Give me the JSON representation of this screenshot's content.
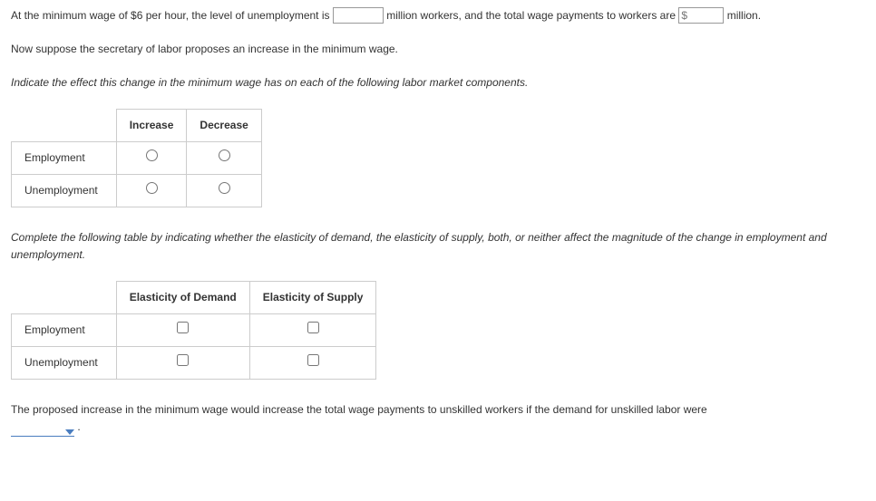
{
  "p1": {
    "a": "At the minimum wage of $6 per hour, the level of unemployment is ",
    "b": " million workers, and the total wage payments to workers are ",
    "money_placeholder": "$",
    "c": " million."
  },
  "p2": "Now suppose the secretary of labor proposes an increase in the minimum wage.",
  "p3": "Indicate the effect this change in the minimum wage has on each of the following labor market components.",
  "t1": {
    "h_inc": "Increase",
    "h_dec": "Decrease",
    "r1": "Employment",
    "r2": "Unemployment"
  },
  "p4": "Complete the following table by indicating whether the elasticity of demand, the elasticity of supply, both, or neither affect the magnitude of the change in employment and unemployment.",
  "t2": {
    "h_ed": "Elasticity of Demand",
    "h_es": "Elasticity of Supply",
    "r1": "Employment",
    "r2": "Unemployment"
  },
  "p5": {
    "a": "The proposed increase in the minimum wage would increase the total wage payments to unskilled workers if the demand for unskilled labor were ",
    "b": "."
  }
}
